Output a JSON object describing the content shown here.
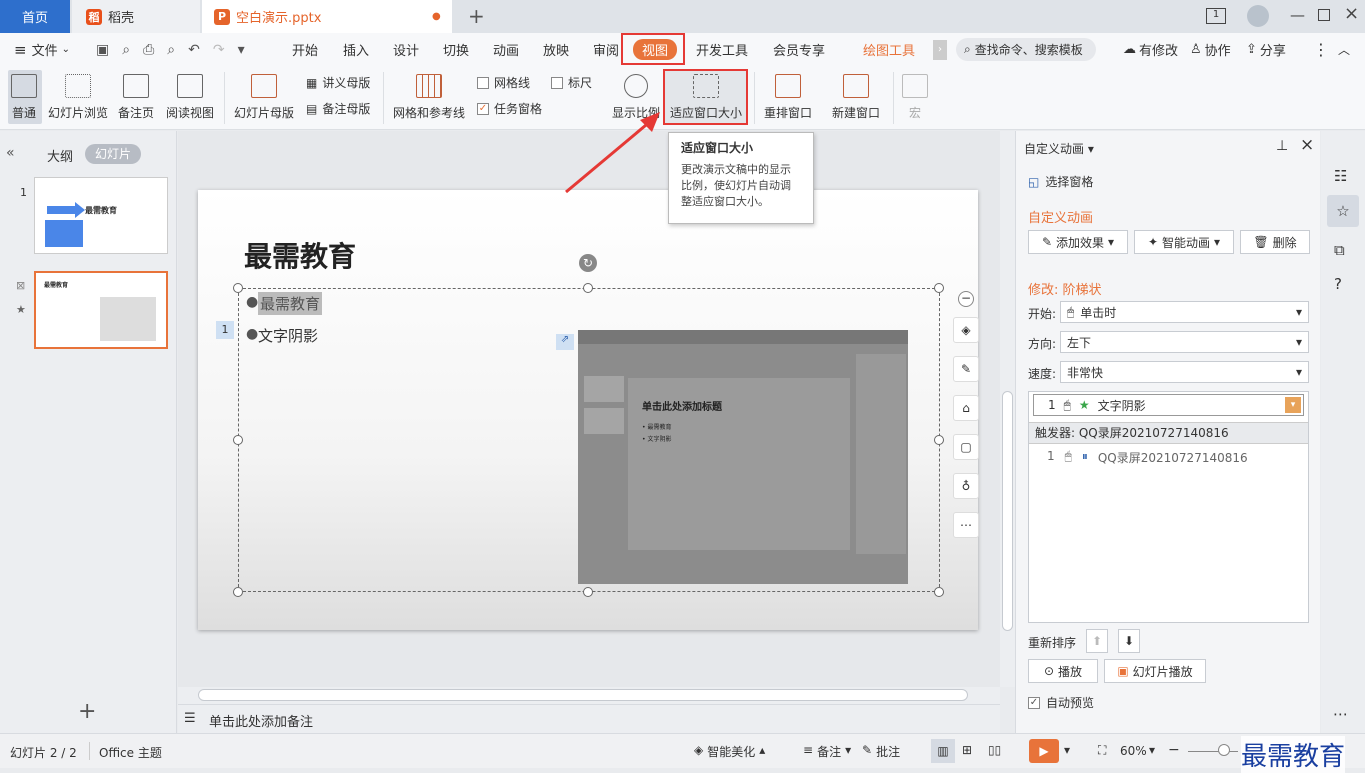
{
  "tabs": {
    "home": "首页",
    "daoke": "稻壳",
    "file": "空白演示.pptx"
  },
  "menu": {
    "file": "文件",
    "items": [
      "开始",
      "插入",
      "设计",
      "切换",
      "动画",
      "放映",
      "审阅",
      "视图",
      "开发工具",
      "会员专享",
      "绘图工具"
    ],
    "search": "查找命令、搜索模板",
    "right": [
      "有修改",
      "协作",
      "分享"
    ]
  },
  "ribbon": {
    "normal": "普通",
    "slide_sorter": "幻灯片浏览",
    "notes_page": "备注页",
    "reading_view": "阅读视图",
    "slide_master": "幻灯片母版",
    "handout_master": "讲义母版",
    "notes_master": "备注母版",
    "grid_guides": "网格和参考线",
    "gridlines": "网格线",
    "ruler": "标尺",
    "task_pane": "任务窗格",
    "zoom": "显示比例",
    "fit_window": "适应窗口大小",
    "arrange": "重排窗口",
    "new_window": "新建窗口",
    "macro": "宏"
  },
  "tooltip": {
    "title": "适应窗口大小",
    "lines": [
      "更改演示文稿中的显示",
      "比例，使幻灯片自动调",
      "整适应窗口大小。"
    ]
  },
  "left_panel": {
    "outline": "大纲",
    "slides": "幻灯片",
    "thumb1_title": "最需教育",
    "thumb2_title": "最需教育",
    "n1": "1",
    "n2": "2"
  },
  "slide": {
    "title": "最需教育",
    "bullet1": "最需教育",
    "bullet2": "文字阴影",
    "anim_tag": "1",
    "embedded_title": "单击此处添加标题",
    "embedded_b1": "• 最需教育",
    "embedded_b2": "• 文字阴影"
  },
  "notes": "单击此处添加备注",
  "right_panel": {
    "header": "自定义动画",
    "select_pane": "选择窗格",
    "section": "自定义动画",
    "add_effect": "添加效果",
    "smart_anim": "智能动画",
    "delete": "删除",
    "modify": "修改: 阶梯状",
    "start_label": "开始:",
    "start_value": "单击时",
    "dir_label": "方向:",
    "dir_value": "左下",
    "speed_label": "速度:",
    "speed_value": "非常快",
    "item1_num": "1",
    "item1_label": "文字阴影",
    "trigger": "触发器: QQ录屏20210727140816",
    "item2_num": "1",
    "item2_label": "QQ录屏20210727140816",
    "reorder": "重新排序",
    "play": "播放",
    "slideshow": "幻灯片播放",
    "autopreview": "自动预览"
  },
  "status": {
    "slide_count": "幻灯片 2 / 2",
    "theme": "Office 主题",
    "smart_beautify": "智能美化",
    "notes": "备注",
    "comments": "批注",
    "zoom": "60%"
  },
  "watermark": "最需教育"
}
